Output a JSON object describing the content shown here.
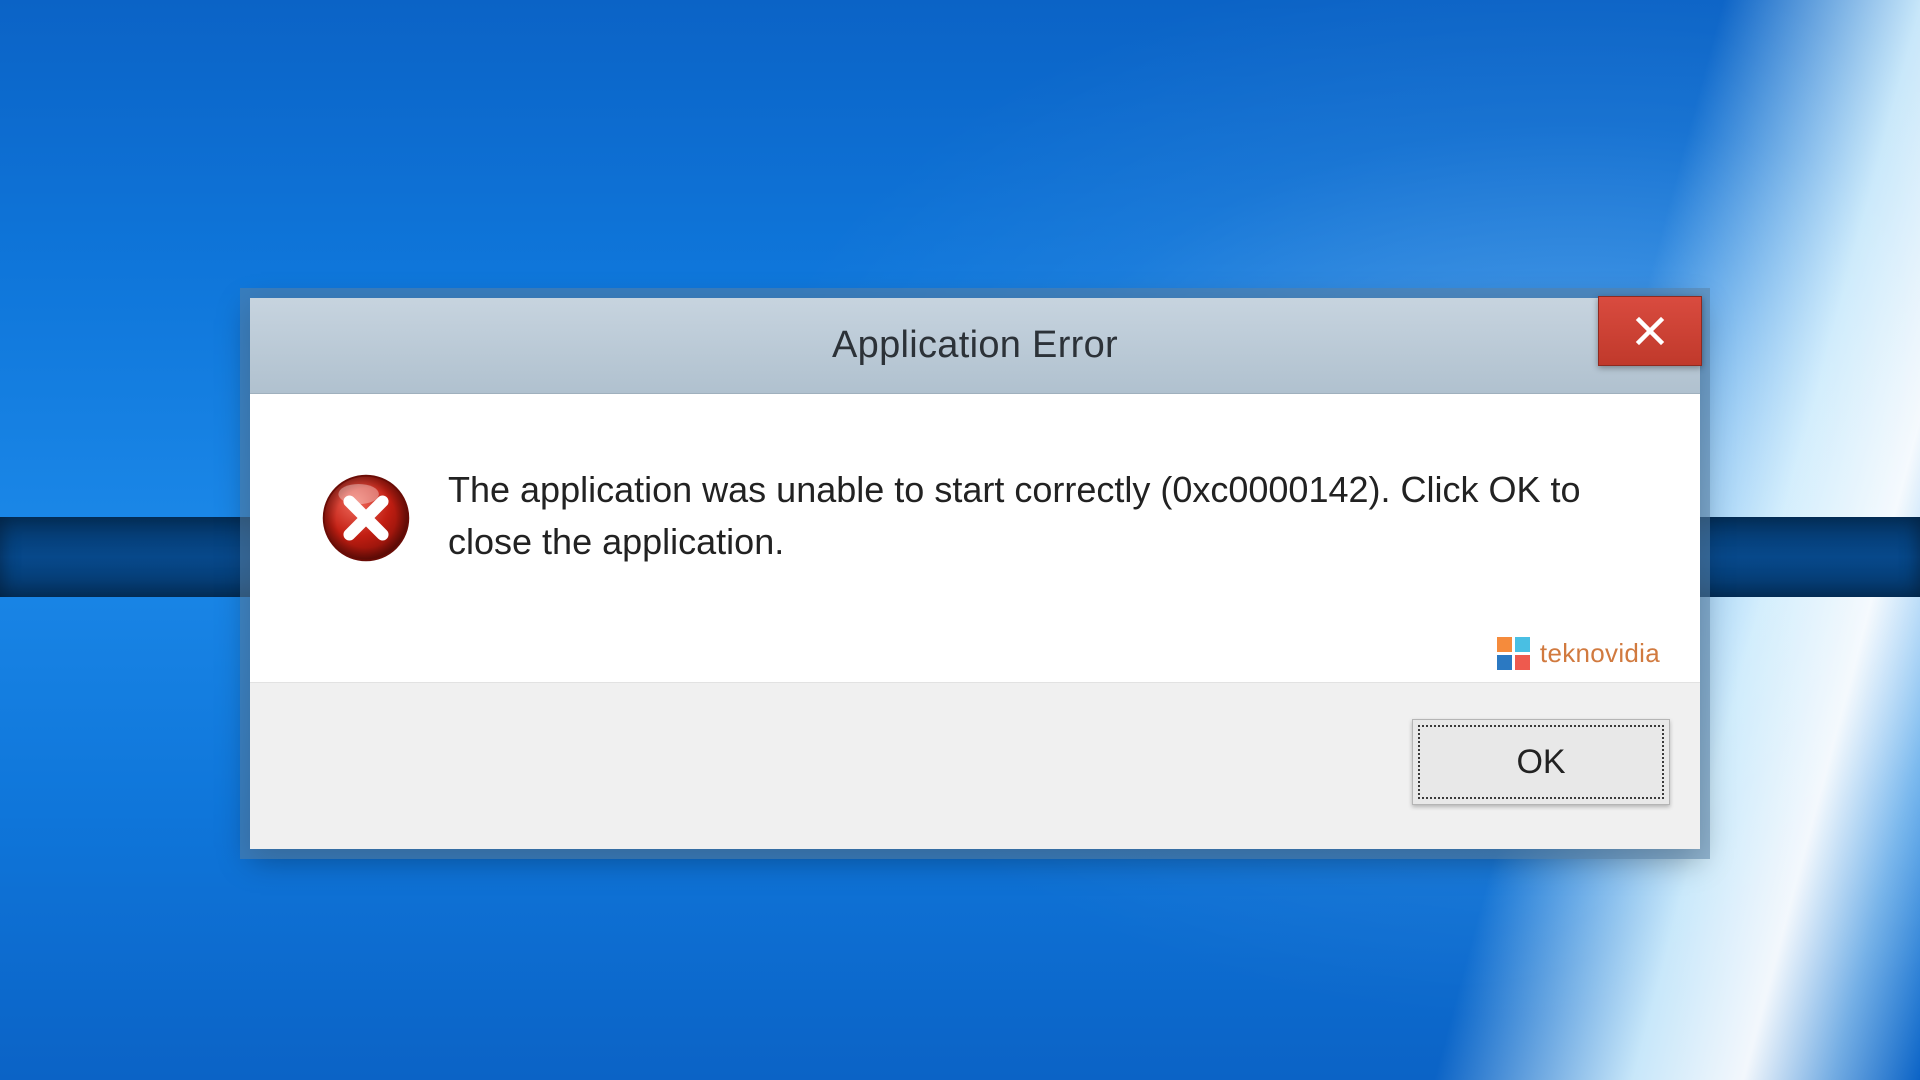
{
  "dialog": {
    "title": "Application Error",
    "message": "The application was unable to start correctly (0xc0000142). Click OK to close the application.",
    "ok_label": "OK"
  },
  "watermark": {
    "text": "teknovidia"
  },
  "colors": {
    "close_bg": "#c0392b",
    "error_icon": "#b6170d",
    "watermark_text": "#d17a3f",
    "watermark_sq_orange": "#f58b3c",
    "watermark_sq_cyan": "#49bfe3",
    "watermark_sq_red": "#ee5a4e",
    "watermark_sq_blue": "#2b79c2"
  }
}
